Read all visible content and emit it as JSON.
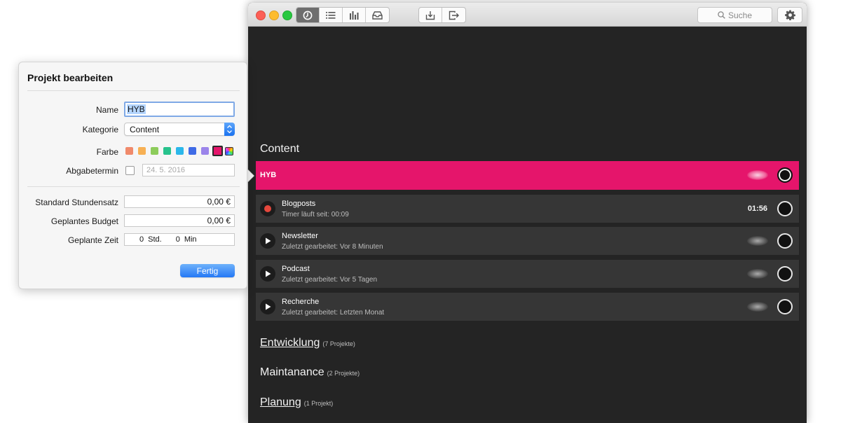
{
  "toolbar": {
    "search_placeholder": "Suche"
  },
  "groups": [
    {
      "title": "Content",
      "projects": [
        {
          "name": "HYB",
          "subtitle": "",
          "highlighted": true,
          "color": "#e5156b"
        },
        {
          "name": "Blogposts",
          "subtitle": "Timer läuft seit: 00:09",
          "running": true,
          "elapsed": "01:56"
        },
        {
          "name": "Newsletter",
          "subtitle": "Zuletzt gearbeitet: Vor 8 Minuten"
        },
        {
          "name": "Podcast",
          "subtitle": "Zuletzt gearbeitet: Vor 5 Tagen"
        },
        {
          "name": "Recherche",
          "subtitle": "Zuletzt gearbeitet: Letzten Monat"
        }
      ]
    },
    {
      "title": "Entwicklung",
      "count": "(7 Projekte)"
    },
    {
      "title": "Maintanance",
      "count": "(2 Projekte)"
    },
    {
      "title": "Planung",
      "count": "(1 Projekt)"
    }
  ],
  "edit": {
    "title": "Projekt bearbeiten",
    "name_label": "Name",
    "name_value": "HYB",
    "category_label": "Kategorie",
    "category_value": "Content",
    "color_label": "Farbe",
    "colors": [
      "#f08a6b",
      "#f7b054",
      "#8dcc5b",
      "#27c28c",
      "#2bb7ea",
      "#3f6be6",
      "#9b84ea",
      "#e5156b"
    ],
    "selected_color": "#e5156b",
    "deadline_label": "Abgabetermin",
    "deadline_checked": false,
    "deadline_value": "24. 5. 2016",
    "rate_label": "Standard Stundensatz",
    "rate_value": "0,00 €",
    "budget_label": "Geplantes Budget",
    "budget_value": "0,00 €",
    "time_label": "Geplante Zeit",
    "time_hours": "0",
    "time_hours_unit": "Std.",
    "time_minutes": "0",
    "time_minutes_unit": "Min",
    "done_label": "Fertig"
  }
}
